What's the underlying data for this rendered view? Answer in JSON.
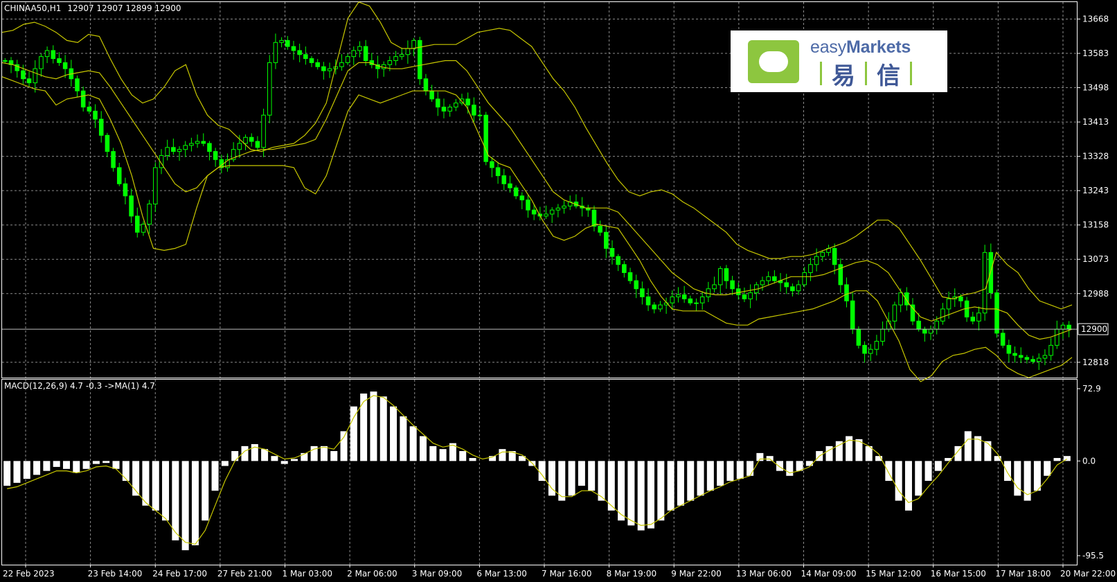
{
  "header": {
    "symbol": "CHINAA50,H1",
    "ohlc": "12907 12907 12899 12900"
  },
  "logo": {
    "brand_light": "easy",
    "brand_bold": "Markets",
    "cn_1": "易",
    "cn_2": "信"
  },
  "colors": {
    "background": "#000000",
    "grid": "#8c8c8c",
    "candle": "#00ff00",
    "bollinger": "#c8c800",
    "macd_hist": "#ffffff",
    "signal": "#c8c800",
    "logo_green": "#8dc63f",
    "logo_blue": "#4d6aa7"
  },
  "chart_data": [
    {
      "type": "line",
      "panel": "price",
      "title": "CHINAA50,H1",
      "x_ticks": [
        "22 Feb 2023",
        "23 Feb 14:00",
        "24 Feb 17:00",
        "27 Feb 21:00",
        "1 Mar 03:00",
        "2 Mar 06:00",
        "3 Mar 09:00",
        "6 Mar 13:00",
        "7 Mar 16:00",
        "8 Mar 19:00",
        "9 Mar 22:00",
        "13 Mar 06:00",
        "14 Mar 09:00",
        "15 Mar 12:00",
        "16 Mar 15:00",
        "17 Mar 18:00",
        "20 Mar 22:00"
      ],
      "y_ticks": [
        13668,
        13583,
        13498,
        13413,
        13328,
        13243,
        13158,
        13073,
        12988,
        12900,
        12818
      ],
      "current_price": 12900,
      "ylim": [
        12780,
        13710
      ],
      "grid": true,
      "series": [
        {
          "style": "candles",
          "close": [
            13565,
            13555,
            13540,
            13520,
            13510,
            13545,
            13575,
            13590,
            13570,
            13560,
            13545,
            13520,
            13490,
            13450,
            13440,
            13420,
            13380,
            13340,
            13300,
            13260,
            13230,
            13180,
            13140,
            13160,
            13210,
            13300,
            13330,
            13350,
            13340,
            13345,
            13355,
            13360,
            13365,
            13360,
            13340,
            13320,
            13300,
            13320,
            13345,
            13360,
            13375,
            13365,
            13350,
            13430,
            13560,
            13610,
            13615,
            13600,
            13590,
            13580,
            13570,
            13560,
            13550,
            13540,
            13545,
            13550,
            13560,
            13575,
            13590,
            13600,
            13565,
            13555,
            13545,
            13555,
            13565,
            13575,
            13580,
            13595,
            13615,
            13520,
            13490,
            13470,
            13450,
            13440,
            13450,
            13460,
            13470,
            13455,
            13430,
            13430,
            13315,
            13300,
            13280,
            13260,
            13250,
            13230,
            13220,
            13195,
            13185,
            13180,
            13185,
            13195,
            13200,
            13205,
            13215,
            13205,
            13200,
            13195,
            13155,
            13140,
            13100,
            13080,
            13060,
            13040,
            13020,
            13000,
            12980,
            12960,
            12950,
            12960,
            12965,
            12980,
            12985,
            12975,
            12965,
            12965,
            12980,
            13000,
            13010,
            13050,
            13020,
            13000,
            12985,
            12975,
            12990,
            13010,
            13020,
            13030,
            13020,
            13015,
            13005,
            12995,
            13010,
            13040,
            13060,
            13080,
            13090,
            13100,
            13060,
            13010,
            12970,
            12900,
            12860,
            12840,
            12850,
            12870,
            12900,
            12920,
            12960,
            12990,
            12960,
            12920,
            12900,
            12890,
            12900,
            12920,
            12950,
            12975,
            12980,
            12970,
            12930,
            12920,
            12940,
            13090,
            12990,
            12890,
            12860,
            12840,
            12835,
            12830,
            12825,
            12820,
            12828,
            12835,
            12860,
            12900,
            12910,
            12900
          ]
        },
        {
          "style": "bollinger",
          "name": "upper",
          "values": [
            13635,
            13640,
            13655,
            13660,
            13650,
            13635,
            13615,
            13610,
            13630,
            13625,
            13570,
            13520,
            13480,
            13460,
            13470,
            13500,
            13540,
            13555,
            13480,
            13430,
            13405,
            13395,
            13370,
            13345,
            13340,
            13350,
            13355,
            13360,
            13380,
            13410,
            13460,
            13565,
            13670,
            13710,
            13700,
            13660,
            13610,
            13595,
            13595,
            13600,
            13605,
            13605,
            13605,
            13620,
            13635,
            13640,
            13645,
            13640,
            13620,
            13600,
            13560,
            13520,
            13490,
            13450,
            13400,
            13355,
            13310,
            13270,
            13240,
            13230,
            13240,
            13245,
            13235,
            13215,
            13200,
            13180,
            13160,
            13140,
            13110,
            13095,
            13085,
            13075,
            13075,
            13080,
            13080,
            13085,
            13095,
            13105,
            13115,
            13130,
            13150,
            13170,
            13170,
            13150,
            13110,
            13070,
            13025,
            12980,
            12975,
            12985,
            12990,
            13000,
            13090,
            13060,
            13040,
            13000,
            12970,
            12960,
            12950,
            12960
          ]
        },
        {
          "style": "bollinger",
          "name": "middle",
          "values": [
            13560,
            13555,
            13545,
            13535,
            13525,
            13520,
            13530,
            13535,
            13540,
            13535,
            13500,
            13460,
            13420,
            13380,
            13340,
            13300,
            13260,
            13240,
            13250,
            13280,
            13300,
            13320,
            13330,
            13340,
            13345,
            13345,
            13350,
            13355,
            13360,
            13370,
            13420,
            13480,
            13540,
            13560,
            13560,
            13550,
            13545,
            13545,
            13550,
            13555,
            13560,
            13565,
            13565,
            13540,
            13500,
            13460,
            13430,
            13400,
            13360,
            13320,
            13280,
            13240,
            13220,
            13210,
            13200,
            13200,
            13200,
            13190,
            13160,
            13130,
            13100,
            13070,
            13040,
            13020,
            13000,
            12990,
            12985,
            12985,
            12990,
            12995,
            13000,
            13010,
            13020,
            13030,
            13030,
            13030,
            13035,
            13045,
            13055,
            13065,
            13070,
            13060,
            13040,
            13000,
            12960,
            12930,
            12920,
            12930,
            12940,
            12950,
            12955,
            12950,
            12950,
            12940,
            12910,
            12885,
            12875,
            12880,
            12890,
            12900
          ]
        },
        {
          "style": "bollinger",
          "name": "lower",
          "values": [
            13525,
            13515,
            13505,
            13495,
            13490,
            13455,
            13470,
            13475,
            13480,
            13470,
            13420,
            13360,
            13280,
            13180,
            13100,
            13095,
            13100,
            13110,
            13200,
            13280,
            13300,
            13305,
            13305,
            13305,
            13305,
            13305,
            13305,
            13300,
            13250,
            13235,
            13280,
            13360,
            13440,
            13480,
            13470,
            13460,
            13470,
            13480,
            13490,
            13490,
            13490,
            13490,
            13480,
            13450,
            13390,
            13330,
            13310,
            13300,
            13260,
            13220,
            13170,
            13130,
            13120,
            13130,
            13150,
            13160,
            13155,
            13150,
            13110,
            13070,
            13020,
            12980,
            12950,
            12945,
            12945,
            12945,
            12930,
            12915,
            12910,
            12910,
            12925,
            12930,
            12935,
            12940,
            12945,
            12950,
            12960,
            12970,
            12985,
            12995,
            12995,
            12970,
            12920,
            12870,
            12800,
            12770,
            12785,
            12820,
            12835,
            12840,
            12850,
            12855,
            12835,
            12805,
            12790,
            12780,
            12790,
            12800,
            12810,
            12830
          ]
        }
      ]
    },
    {
      "type": "bar",
      "panel": "macd",
      "title": "MACD(12,26,9) 4.7 -0.3  ->MA(1) 4.7",
      "y_ticks": [
        72.9,
        0.0,
        -95.5
      ],
      "ylim": [
        -95.5,
        72.9
      ],
      "series": [
        {
          "style": "histogram",
          "values": [
            -25,
            -22,
            -18,
            -14,
            -10,
            -6,
            -8,
            -12,
            -8,
            -3,
            -2,
            -8,
            -20,
            -35,
            -45,
            -50,
            -60,
            -80,
            -90,
            -85,
            -60,
            -30,
            -5,
            10,
            15,
            17,
            12,
            5,
            -3,
            2,
            8,
            15,
            15,
            10,
            30,
            55,
            68,
            70,
            65,
            55,
            45,
            35,
            25,
            15,
            12,
            18,
            10,
            3,
            0,
            5,
            12,
            10,
            5,
            -5,
            -20,
            -35,
            -40,
            -35,
            -25,
            -30,
            -40,
            -50,
            -60,
            -65,
            -70,
            -68,
            -60,
            -50,
            -45,
            -40,
            -35,
            -30,
            -25,
            -20,
            -18,
            -15,
            8,
            5,
            -10,
            -15,
            -10,
            -5,
            10,
            15,
            20,
            25,
            22,
            15,
            5,
            -20,
            -40,
            -50,
            -35,
            -20,
            -10,
            3,
            15,
            30,
            25,
            20,
            5,
            -20,
            -35,
            -40,
            -30,
            -15,
            3,
            5
          ]
        },
        {
          "style": "signal",
          "values": [
            -28,
            -26,
            -22,
            -18,
            -14,
            -10,
            -10,
            -12,
            -10,
            -6,
            -5,
            -8,
            -18,
            -30,
            -42,
            -50,
            -58,
            -72,
            -82,
            -84,
            -70,
            -45,
            -20,
            0,
            10,
            14,
            12,
            7,
            2,
            3,
            7,
            12,
            14,
            12,
            24,
            44,
            60,
            66,
            64,
            56,
            46,
            36,
            27,
            18,
            14,
            16,
            12,
            6,
            2,
            4,
            9,
            9,
            6,
            -2,
            -14,
            -28,
            -36,
            -36,
            -30,
            -30,
            -36,
            -45,
            -54,
            -60,
            -65,
            -64,
            -58,
            -50,
            -45,
            -40,
            -35,
            -30,
            -26,
            -21,
            -18,
            -15,
            2,
            2,
            -6,
            -12,
            -10,
            -6,
            5,
            11,
            16,
            21,
            20,
            15,
            7,
            -12,
            -30,
            -42,
            -38,
            -26,
            -15,
            -2,
            10,
            22,
            22,
            18,
            7,
            -12,
            -27,
            -34,
            -30,
            -18,
            -4,
            2
          ]
        }
      ]
    }
  ]
}
